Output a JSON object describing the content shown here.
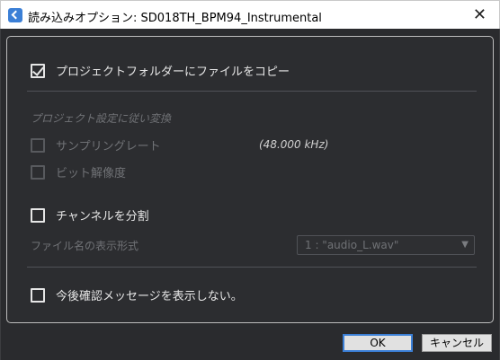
{
  "window": {
    "title": "読み込みオプション: SD018TH_BPM94_Instrumental",
    "close_glyph": "✕"
  },
  "options": {
    "copy_to_project": {
      "label": "プロジェクトフォルダーにファイルをコピー",
      "checked": true
    },
    "convert_section_label": "プロジェクト設定に従い変換",
    "sample_rate": {
      "label": "サンプリングレート",
      "checked": false,
      "value": "(48.000 kHz)"
    },
    "bit_depth": {
      "label": "ビット解像度",
      "checked": false
    },
    "split_channels": {
      "label": "チャンネルを分割",
      "checked": false
    },
    "file_name_format": {
      "label": "ファイル名の表示形式",
      "selected": "1 : \"audio_L.wav\""
    },
    "dont_show_again": {
      "label": "今後確認メッセージを表示しない。",
      "checked": false
    }
  },
  "buttons": {
    "ok": "OK",
    "cancel": "キャンセル"
  },
  "icons": {
    "app": "cubase-logo-icon",
    "close": "close-icon",
    "dropdown": "chevron-down-icon"
  },
  "colors": {
    "accent": "#3b7fd6",
    "background": "#2a2b2e"
  }
}
